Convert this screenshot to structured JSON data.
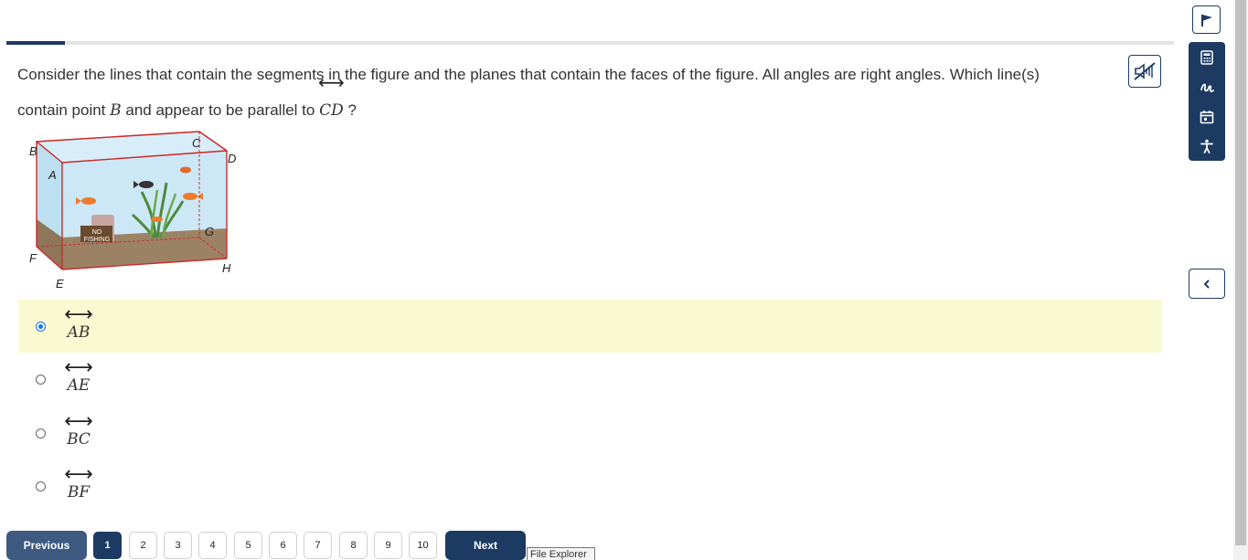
{
  "progress": {
    "fraction": 0.05
  },
  "question": {
    "text_before": "Consider the lines that contain the segments in the figure and the planes that contain the faces of the figure. All angles are right angles. Which line(s) contain point ",
    "point": "B",
    "text_middle": " and appear to be parallel to ",
    "line": "CD",
    "text_after": " ?",
    "arrow": "⟷"
  },
  "figure": {
    "vertex_labels": [
      "A",
      "B",
      "C",
      "D",
      "E",
      "F",
      "G",
      "H"
    ],
    "sign_line1": "NO",
    "sign_line2": "FISHING"
  },
  "choices": [
    {
      "label": "AB",
      "selected": true
    },
    {
      "label": "AE",
      "selected": false
    },
    {
      "label": "BC",
      "selected": false
    },
    {
      "label": "BF",
      "selected": false
    }
  ],
  "nav": {
    "previous": "Previous",
    "next": "Next",
    "pages": [
      "1",
      "2",
      "3",
      "4",
      "5",
      "6",
      "7",
      "8",
      "9",
      "10"
    ],
    "current_page": "1"
  },
  "tooltip": "File Explorer",
  "tools": [
    "flag-icon",
    "calculator-icon",
    "highlighter-icon",
    "calendar-icon",
    "accessibility-icon",
    "mute-icon",
    "chevron-left-icon"
  ],
  "colors": {
    "accent": "#1d3a63",
    "selected_bg": "#fafad2",
    "radio": "#1a73e8"
  }
}
